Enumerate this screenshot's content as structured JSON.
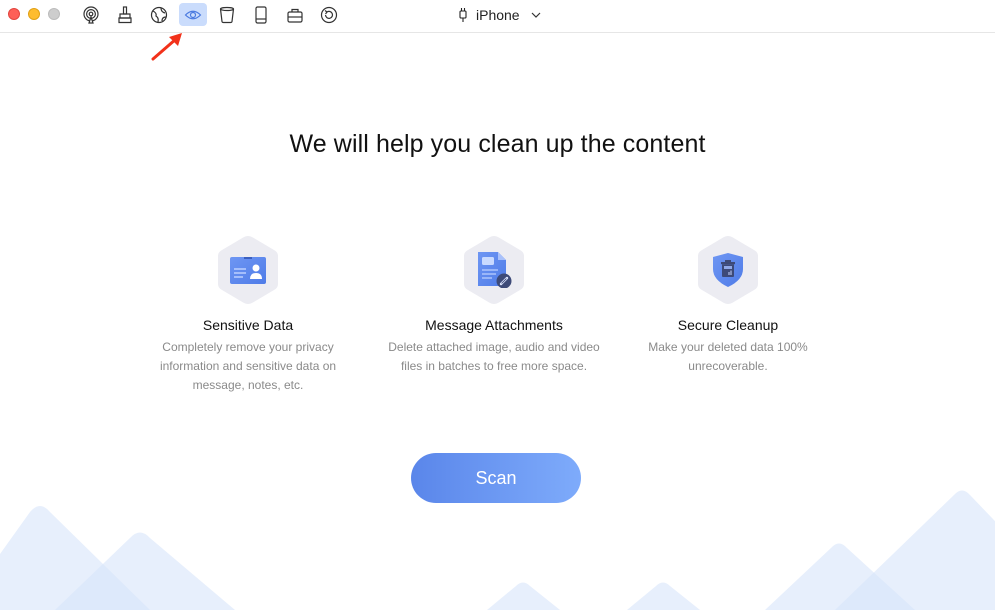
{
  "window": {
    "controls": [
      "close",
      "minimize",
      "maximize"
    ]
  },
  "toolbar": {
    "tools": [
      {
        "name": "airplay-icon",
        "active": false
      },
      {
        "name": "cleaner-brush-icon",
        "active": false
      },
      {
        "name": "globe-icon",
        "active": false
      },
      {
        "name": "privacy-eye-icon",
        "active": true
      },
      {
        "name": "trash-bin-icon",
        "active": false
      },
      {
        "name": "device-icon",
        "active": false
      },
      {
        "name": "toolbox-icon",
        "active": false
      },
      {
        "name": "restore-icon",
        "active": false
      }
    ],
    "device_name": "iPhone",
    "accent_color": "#cadcfc"
  },
  "main": {
    "headline": "We will help you clean up the content",
    "features": [
      {
        "icon": "id-card-icon",
        "title": "Sensitive Data",
        "description": "Completely remove your privacy information and sensitive data on message, notes, etc."
      },
      {
        "icon": "attachment-document-icon",
        "title": "Message Attachments",
        "description": "Delete attached image, audio and video files in batches to free more space."
      },
      {
        "icon": "secure-shield-icon",
        "title": "Secure Cleanup",
        "description": "Make your deleted data 100% unrecoverable."
      }
    ],
    "scan_label": "Scan"
  },
  "colors": {
    "primary_gradient_start": "#5a86ea",
    "primary_gradient_end": "#7eabfb",
    "annotation_arrow": "#f2311a",
    "mountain": "#dce8fb"
  }
}
